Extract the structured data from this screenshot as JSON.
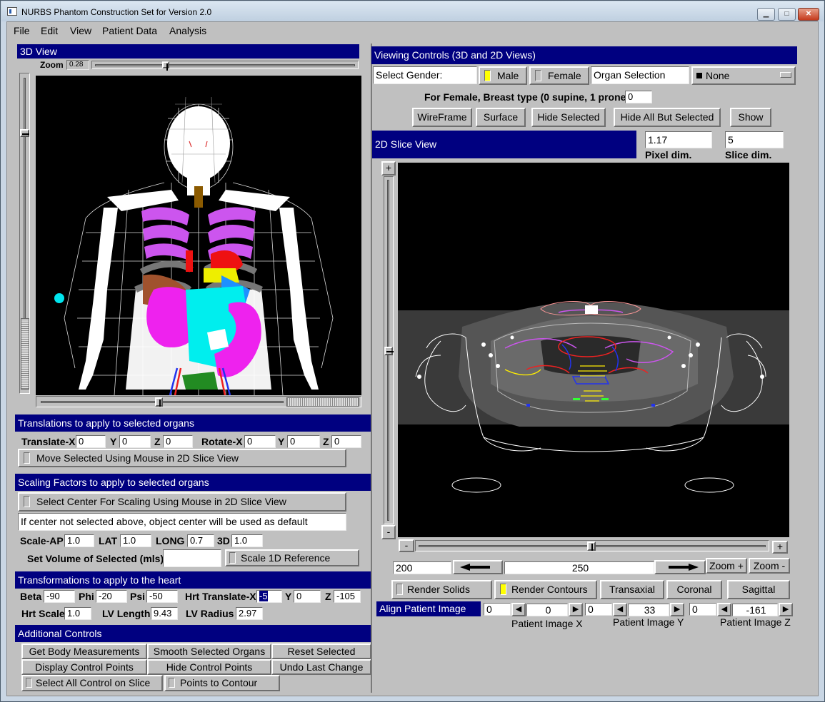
{
  "window": {
    "title": "NURBS Phantom Construction Set for Version 2.0",
    "minimize": "▁",
    "maximize": "□",
    "close": "✕"
  },
  "menu": [
    "File",
    "Edit",
    "View",
    "Patient Data",
    "Analysis"
  ],
  "view3d": {
    "header": "3D View",
    "zoom_label": "Zoom",
    "zoom_value": "0.28"
  },
  "viewing": {
    "header": "Viewing Controls (3D and 2D Views)",
    "select_gender": "Select Gender:",
    "male": "Male",
    "female": "Female",
    "organ_selection": "Organ Selection",
    "organ_value": "None",
    "breast_label": "For Female, Breast type (0 supine, 1 prone)",
    "breast_value": "0",
    "buttons": {
      "wireframe": "WireFrame",
      "surface": "Surface",
      "hide_selected": "Hide Selected",
      "hide_all_but": "Hide All But Selected",
      "show": "Show"
    }
  },
  "slice2d": {
    "header": "2D Slice View",
    "pixel_dim_value": "1.17",
    "pixel_dim_label": "Pixel dim.",
    "slice_dim_value": "5",
    "slice_dim_label": "Slice dim.",
    "plus": "+",
    "minus": "-",
    "level_min": "200",
    "level_value": "250",
    "zoom_in": "Zoom +",
    "zoom_out": "Zoom -",
    "render_solids": "Render Solids",
    "render_contours": "Render Contours",
    "transaxial": "Transaxial",
    "coronal": "Coronal",
    "sagittal": "Sagittal",
    "align": "Align Patient Image",
    "align_x": {
      "field": "0",
      "value": "0",
      "label": "Patient Image X"
    },
    "align_y": {
      "field": "0",
      "value": "33",
      "label": "Patient Image Y"
    },
    "align_z": {
      "field": "0",
      "value": "-161",
      "label": "Patient Image Z"
    }
  },
  "translations": {
    "header": "Translations to apply to selected organs",
    "tx_label": "Translate-X",
    "tx": "0",
    "y_label": "Y",
    "y": "0",
    "z_label": "Z",
    "z": "0",
    "rx_label": "Rotate-X",
    "rx": "0",
    "ry_label": "Y",
    "ry": "0",
    "rz_label": "Z",
    "rz": "0",
    "move_button": "Move Selected Using Mouse in 2D Slice View"
  },
  "scaling": {
    "header": "Scaling Factors to apply to selected organs",
    "center_button": "Select Center For Scaling Using Mouse in 2D Slice View",
    "note": "If center not selected above, object center will be used as default",
    "ap_label": "Scale-AP",
    "ap": "1.0",
    "lat_label": "LAT",
    "lat": "1.0",
    "long_label": "LONG",
    "long": "0.7",
    "d3_label": "3D",
    "d3": "1.0",
    "volume_label": "Set Volume of Selected (mls):",
    "volume_value": "",
    "scale1d_button": "Scale 1D Reference"
  },
  "heart": {
    "header": "Transformations to apply to the heart",
    "beta_label": "Beta",
    "beta": "-90",
    "phi_label": "Phi",
    "phi": "-20",
    "psi_label": "Psi",
    "psi": "-50",
    "htx_label": "Hrt Translate-X",
    "htx": "-5",
    "hy_label": "Y",
    "hy": "0",
    "hz_label": "Z",
    "hz": "-105",
    "hscale_label": "Hrt Scale",
    "hscale": "1.0",
    "lvlen_label": "LV Length",
    "lvlen": "9.43",
    "lvrad_label": "LV Radius",
    "lvrad": "2.97"
  },
  "additional": {
    "header": "Additional Controls",
    "get_body": "Get Body Measurements",
    "smooth": "Smooth Selected Organs",
    "reset": "Reset Selected",
    "display_cp": "Display Control Points",
    "hide_cp": "Hide Control Points",
    "undo": "Undo Last Change",
    "select_all": "Select All Control on Slice",
    "points_contour": "Points to Contour"
  }
}
